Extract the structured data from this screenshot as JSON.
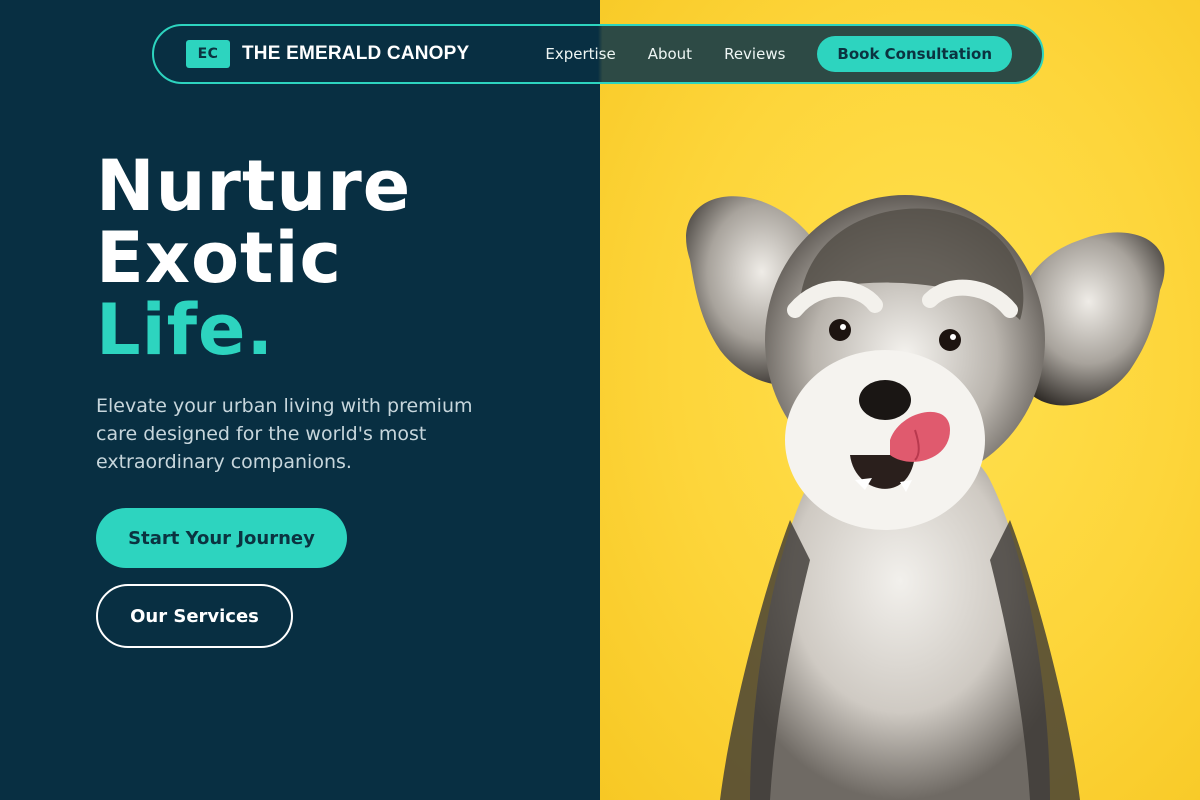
{
  "brand": {
    "logo_text": "EC",
    "name": "THE EMERALD CANOPY"
  },
  "nav": {
    "links": [
      "Expertise",
      "About",
      "Reviews"
    ],
    "cta_label": "Book Consultation"
  },
  "hero": {
    "title_lines": [
      "Nurture",
      "Exotic"
    ],
    "title_accent": "Life.",
    "subtitle": "Elevate your urban living with premium care designed for the world's most extraordinary companions.",
    "primary_button": "Start Your Journey",
    "secondary_button": "Our Services"
  },
  "image": {
    "subject": "dog-photo",
    "alt": "Schnauzer dog on yellow background"
  },
  "colors": {
    "dark_bg": "#082f42",
    "accent": "#2dd4bf",
    "photo_bg": "#fdd53a",
    "text_muted": "#c7d6dc"
  }
}
